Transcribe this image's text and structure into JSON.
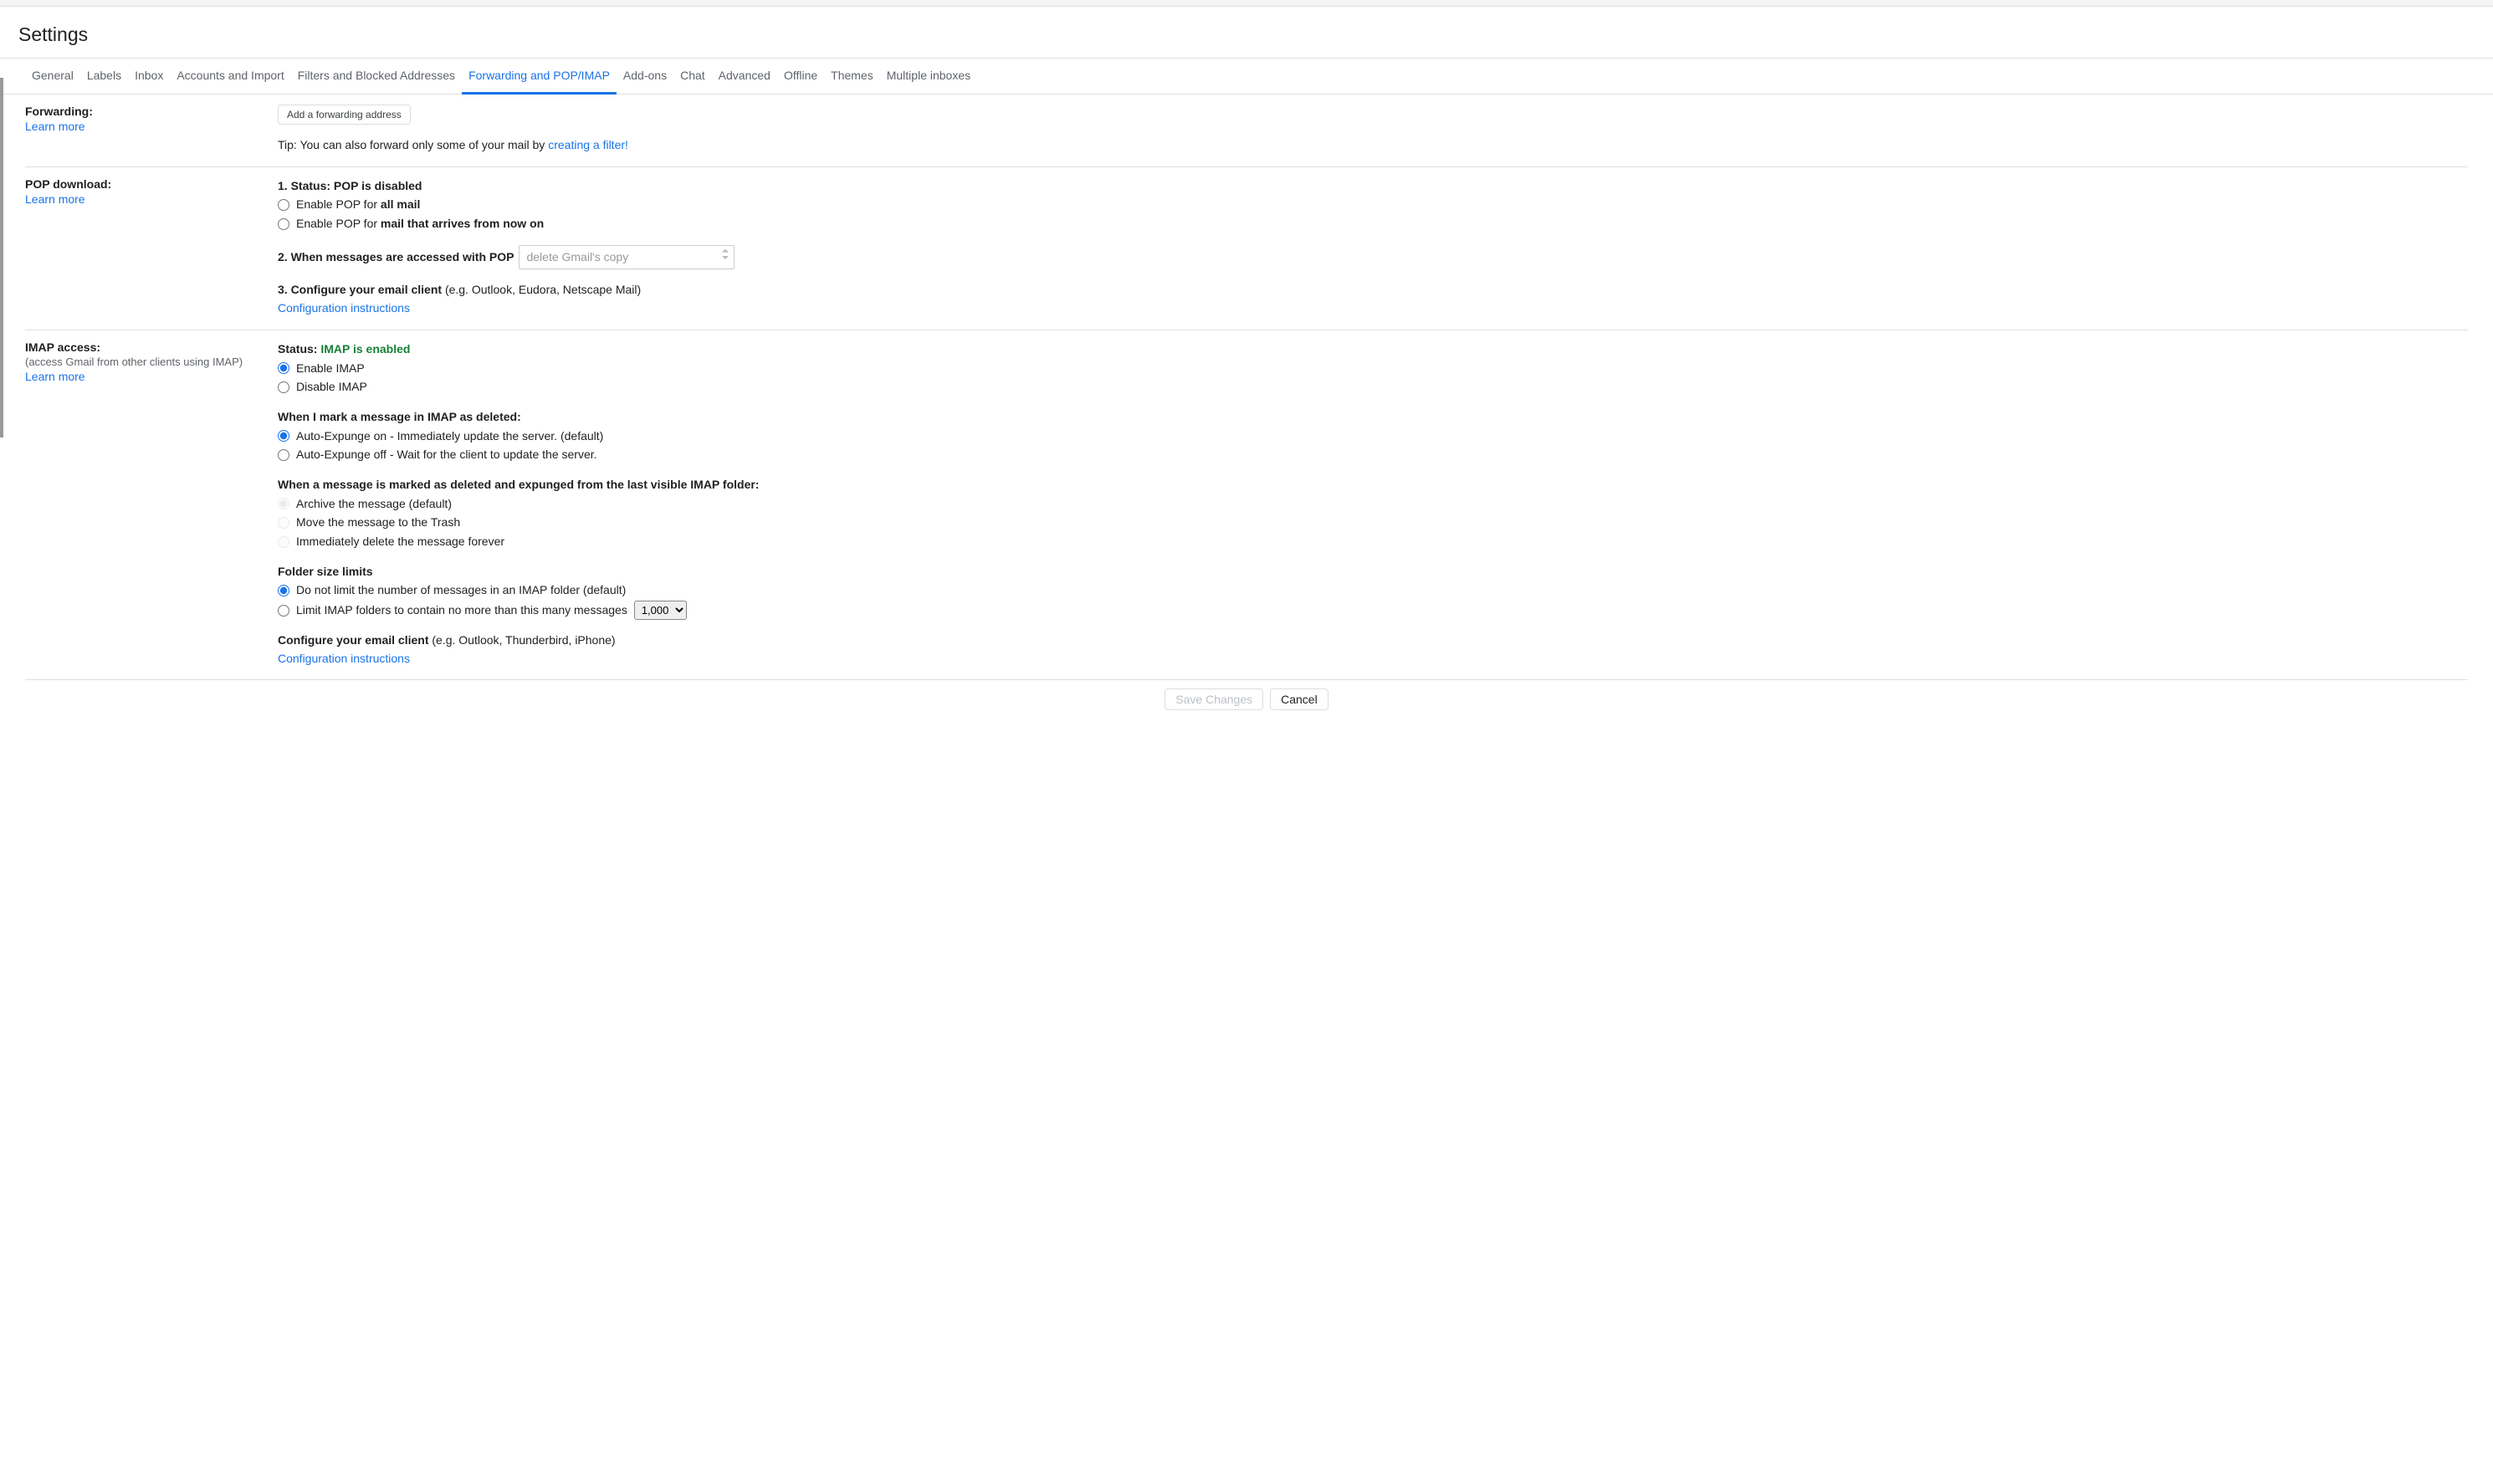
{
  "header": {
    "title": "Settings"
  },
  "tabs": [
    {
      "label": "General",
      "active": false
    },
    {
      "label": "Labels",
      "active": false
    },
    {
      "label": "Inbox",
      "active": false
    },
    {
      "label": "Accounts and Import",
      "active": false
    },
    {
      "label": "Filters and Blocked Addresses",
      "active": false
    },
    {
      "label": "Forwarding and POP/IMAP",
      "active": true
    },
    {
      "label": "Add-ons",
      "active": false
    },
    {
      "label": "Chat",
      "active": false
    },
    {
      "label": "Advanced",
      "active": false
    },
    {
      "label": "Offline",
      "active": false
    },
    {
      "label": "Themes",
      "active": false
    },
    {
      "label": "Multiple inboxes",
      "active": false
    }
  ],
  "forwarding": {
    "label": "Forwarding:",
    "learn_more": "Learn more",
    "add_button": "Add a forwarding address",
    "tip_prefix": "Tip: You can also forward only some of your mail by ",
    "tip_link": "creating a filter!"
  },
  "pop": {
    "label": "POP download:",
    "learn_more": "Learn more",
    "status_prefix": "1. Status: ",
    "status_value": "POP is disabled",
    "enable_all_prefix": "Enable POP for ",
    "enable_all_bold": "all mail",
    "enable_now_prefix": "Enable POP for ",
    "enable_now_bold": "mail that arrives from now on",
    "accessed_label": "2. When messages are accessed with POP",
    "accessed_select": "delete Gmail's copy",
    "configure_prefix": "3. Configure your email client ",
    "configure_suffix": "(e.g. Outlook, Eudora, Netscape Mail)",
    "configure_link": "Configuration instructions"
  },
  "imap": {
    "label": "IMAP access:",
    "subtitle": "(access Gmail from other clients using IMAP)",
    "learn_more": "Learn more",
    "status_prefix": "Status: ",
    "status_value": "IMAP is enabled",
    "enable_label": "Enable IMAP",
    "disable_label": "Disable IMAP",
    "deleted_header": "When I mark a message in IMAP as deleted:",
    "expunge_on": "Auto-Expunge on - Immediately update the server. (default)",
    "expunge_off": "Auto-Expunge off - Wait for the client to update the server.",
    "expunged_header": "When a message is marked as deleted and expunged from the last visible IMAP folder:",
    "archive_option": "Archive the message (default)",
    "trash_option": "Move the message to the Trash",
    "delete_option": "Immediately delete the message forever",
    "folder_header": "Folder size limits",
    "nolimit_option": "Do not limit the number of messages in an IMAP folder (default)",
    "limit_option": "Limit IMAP folders to contain no more than this many messages",
    "limit_select": "1,000",
    "configure_prefix": "Configure your email client ",
    "configure_suffix": "(e.g. Outlook, Thunderbird, iPhone)",
    "configure_link": "Configuration instructions"
  },
  "footer": {
    "save": "Save Changes",
    "cancel": "Cancel"
  }
}
